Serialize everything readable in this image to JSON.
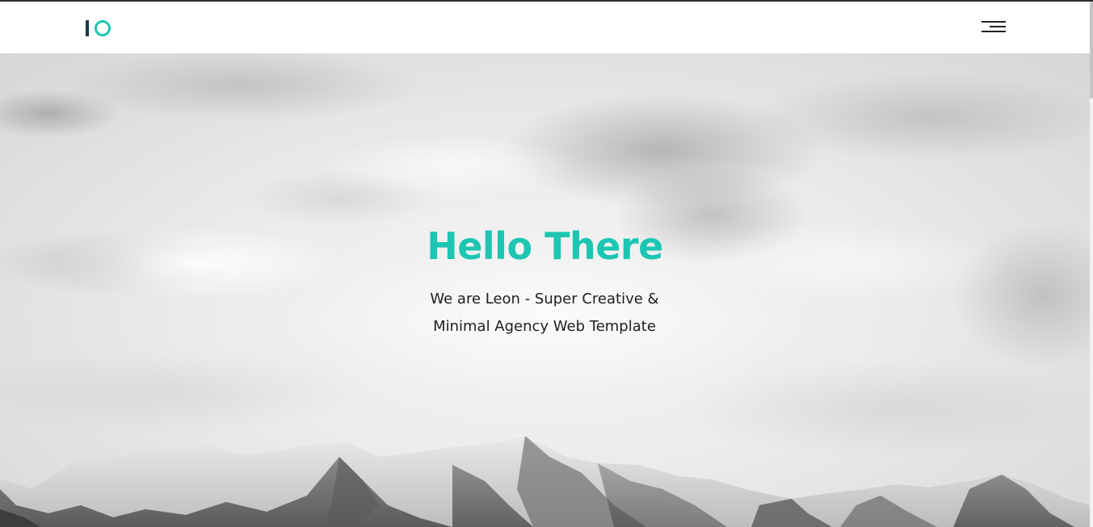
{
  "header": {
    "logo_text": "IO",
    "menu_icon": "hamburger-menu-icon"
  },
  "hero": {
    "title": "Hello There",
    "subtitle_line1": "We are Leon - Super Creative &",
    "subtitle_line2": "Minimal Agency Web Template",
    "background": "cloudy-sky-snowy-mountains-grayscale"
  },
  "colors": {
    "accent": "#1cc6b2",
    "logo_dark": "#1b3a45",
    "text": "#1e1e1e",
    "header_bg": "#ffffff"
  }
}
